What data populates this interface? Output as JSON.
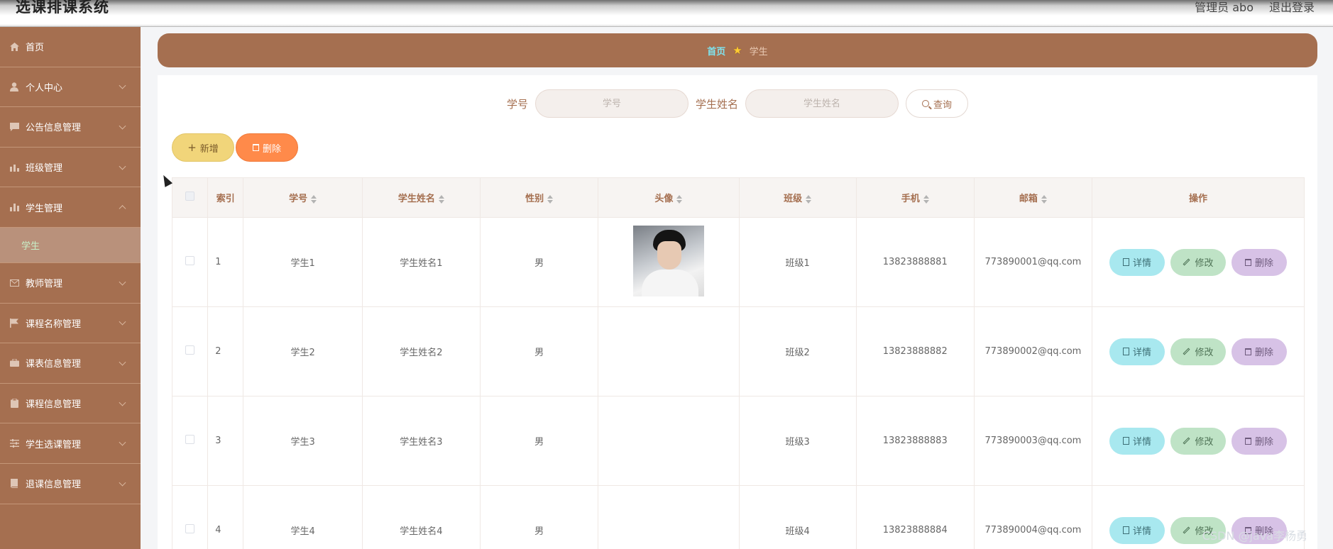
{
  "header": {
    "app_title": "选课排课系统",
    "user_label": "管理员 abo",
    "logout_label": "退出登录"
  },
  "sidebar": {
    "items": [
      {
        "label": "首页",
        "icon": "home-icon"
      },
      {
        "label": "个人中心",
        "icon": "user-icon"
      },
      {
        "label": "公告信息管理",
        "icon": "message-icon"
      },
      {
        "label": "班级管理",
        "icon": "bar-chart-icon"
      },
      {
        "label": "学生管理",
        "icon": "chart-icon",
        "expanded": true
      },
      {
        "label": "教师管理",
        "icon": "mail-icon"
      },
      {
        "label": "课程名称管理",
        "icon": "flag-icon"
      },
      {
        "label": "课表信息管理",
        "icon": "briefcase-icon"
      },
      {
        "label": "课程信息管理",
        "icon": "clipboard-icon"
      },
      {
        "label": "学生选课管理",
        "icon": "sliders-icon"
      },
      {
        "label": "退课信息管理",
        "icon": "book-icon"
      }
    ],
    "sub_active": "学生"
  },
  "breadcrumb": {
    "home": "首页",
    "current": "学生"
  },
  "search": {
    "label_id": "学号",
    "placeholder_id": "学号",
    "label_name": "学生姓名",
    "placeholder_name": "学生姓名",
    "button": "查询"
  },
  "actions": {
    "add": "新增",
    "delete": "删除"
  },
  "table": {
    "columns": [
      "索引",
      "学号",
      "学生姓名",
      "性别",
      "头像",
      "班级",
      "手机",
      "邮箱",
      "操作"
    ],
    "rows": [
      {
        "index": "1",
        "id": "学生1",
        "name": "学生姓名1",
        "gender": "男",
        "has_avatar": true,
        "class": "班级1",
        "phone": "13823888881",
        "email": "773890001@qq.com"
      },
      {
        "index": "2",
        "id": "学生2",
        "name": "学生姓名2",
        "gender": "男",
        "has_avatar": false,
        "class": "班级2",
        "phone": "13823888882",
        "email": "773890002@qq.com"
      },
      {
        "index": "3",
        "id": "学生3",
        "name": "学生姓名3",
        "gender": "男",
        "has_avatar": false,
        "class": "班级3",
        "phone": "13823888883",
        "email": "773890003@qq.com"
      },
      {
        "index": "4",
        "id": "学生4",
        "name": "学生姓名4",
        "gender": "男",
        "has_avatar": false,
        "class": "班级4",
        "phone": "13823888884",
        "email": "773890004@qq.com"
      }
    ],
    "row_actions": {
      "detail": "详情",
      "edit": "修改",
      "delete": "删除"
    }
  },
  "watermark": "CSDN @java李杨勇",
  "colors": {
    "brand": "#a56f50",
    "breadcrumb_home": "#7fe3ee",
    "add": "#f1d57a",
    "delete": "#ff8a4a",
    "detail": "#a8e8ef",
    "edit": "#bfe3c6",
    "row_delete": "#d7c2e6"
  }
}
